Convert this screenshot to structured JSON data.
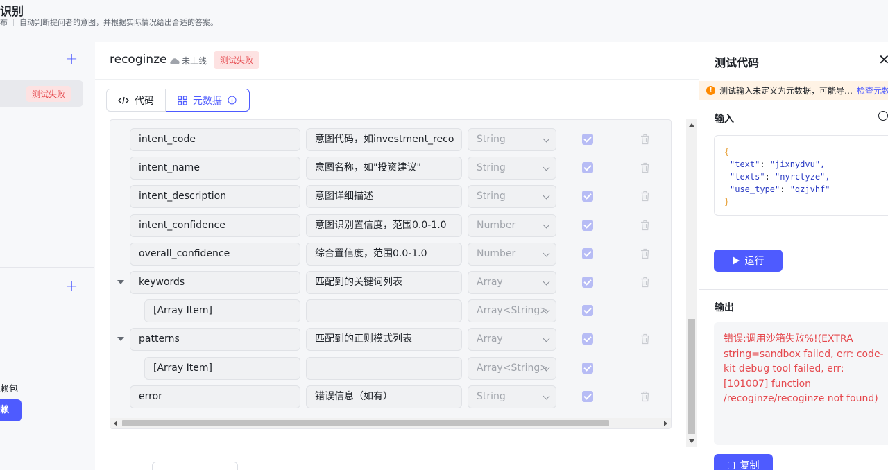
{
  "header": {
    "title": "识别",
    "status_prefix": "布",
    "description": "自动判断提问者的意图，并根据实际情况给出合适的答案。"
  },
  "sidebar": {
    "selected_badge": "测试失败",
    "deps_label": "赖包",
    "deps_button": "赖"
  },
  "editor": {
    "function_name": "recoginze",
    "online_status": "未上线",
    "test_badge": "测试失败",
    "tabs": [
      {
        "label": "代码"
      },
      {
        "label": "元数据"
      }
    ],
    "rows": [
      {
        "name": "intent_code",
        "desc": "意图代码，如investment_reco",
        "type": "String",
        "child": false,
        "expandable": false,
        "deletable": true
      },
      {
        "name": "intent_name",
        "desc": "意图名称，如\"投资建议\"",
        "type": "String",
        "child": false,
        "expandable": false,
        "deletable": true
      },
      {
        "name": "intent_description",
        "desc": "意图详细描述",
        "type": "String",
        "child": false,
        "expandable": false,
        "deletable": true
      },
      {
        "name": "intent_confidence",
        "desc": "意图识别置信度，范围0.0-1.0",
        "type": "Number",
        "child": false,
        "expandable": false,
        "deletable": true
      },
      {
        "name": "overall_confidence",
        "desc": "综合置信度，范围0.0-1.0",
        "type": "Number",
        "child": false,
        "expandable": false,
        "deletable": true
      },
      {
        "name": "keywords",
        "desc": "匹配到的关键词列表",
        "type": "Array",
        "child": false,
        "expandable": true,
        "deletable": true
      },
      {
        "name": "[Array Item]",
        "desc": "",
        "type": "Array<String>",
        "child": true,
        "expandable": false,
        "deletable": false
      },
      {
        "name": "patterns",
        "desc": "匹配到的正则模式列表",
        "type": "Array",
        "child": false,
        "expandable": true,
        "deletable": true
      },
      {
        "name": "[Array Item]",
        "desc": "",
        "type": "Array<String>",
        "child": true,
        "expandable": false,
        "deletable": false
      },
      {
        "name": "error",
        "desc": "错误信息（如有）",
        "type": "String",
        "child": false,
        "expandable": false,
        "deletable": true
      }
    ]
  },
  "test_panel": {
    "title": "测试代码",
    "warning": "测试输入未定义为元数据，可能导…",
    "warning_link": "检查元数",
    "input_label": "输入",
    "input_json": {
      "open": "{",
      "lines": [
        {
          "key": "\"text\"",
          "value": "\"jixnydvu\","
        },
        {
          "key": "\"texts\"",
          "value": "\"nyrctyze\","
        },
        {
          "key": "\"use_type\"",
          "value": "\"qzjvhf\""
        }
      ],
      "close": "}"
    },
    "run_button": "运行",
    "output_label": "输出",
    "output_text": "错误:调用沙箱失败%!(EXTRA string=sandbox failed, err: code-kit debug tool failed, err: [101007] function /recoginze/recoginze not found)",
    "copy_button": "复制"
  },
  "colors": {
    "accent": "#4e5bff",
    "error": "#e5484d",
    "warning_bg": "#fff3e5"
  }
}
